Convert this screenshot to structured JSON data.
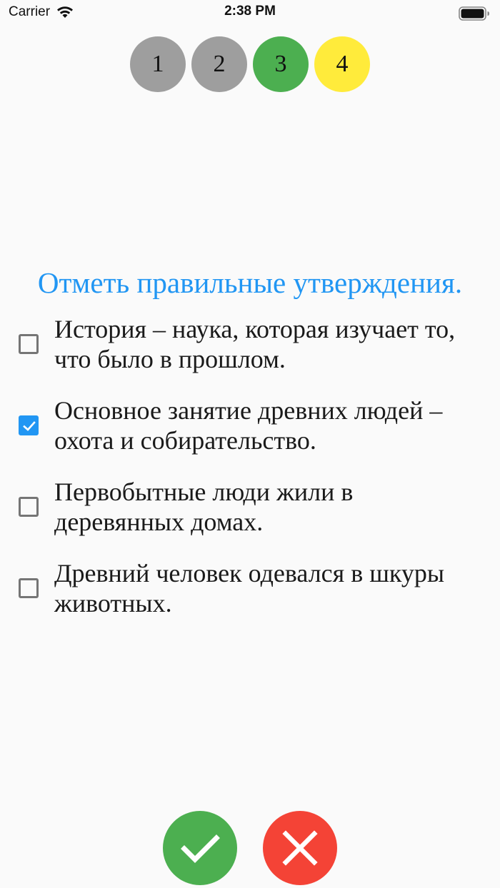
{
  "status_bar": {
    "carrier": "Carrier",
    "time": "2:38 PM",
    "icons": [
      "wifi-icon",
      "battery-icon"
    ]
  },
  "steps": [
    {
      "label": "1",
      "state": "done",
      "color": "#9e9e9e"
    },
    {
      "label": "2",
      "state": "done",
      "color": "#9e9e9e"
    },
    {
      "label": "3",
      "state": "correct",
      "color": "#4caf50"
    },
    {
      "label": "4",
      "state": "current",
      "color": "#ffeb3b"
    }
  ],
  "question": {
    "title": "Отметь правильные утверждения.",
    "title_color": "#2196f3",
    "options": [
      {
        "text": "История – наука, которая изучает то, что было в прошлом.",
        "checked": false
      },
      {
        "text": "Основное занятие древних людей – охота и собирательство.",
        "checked": true
      },
      {
        "text": "Первобытные люди жили в деревянных домах.",
        "checked": false
      },
      {
        "text": "Древний человек одевался в шкуры животных.",
        "checked": false
      }
    ]
  },
  "actions": {
    "confirm": {
      "icon": "check-icon",
      "color": "#4caf50"
    },
    "cancel": {
      "icon": "close-icon",
      "color": "#f44336"
    }
  }
}
